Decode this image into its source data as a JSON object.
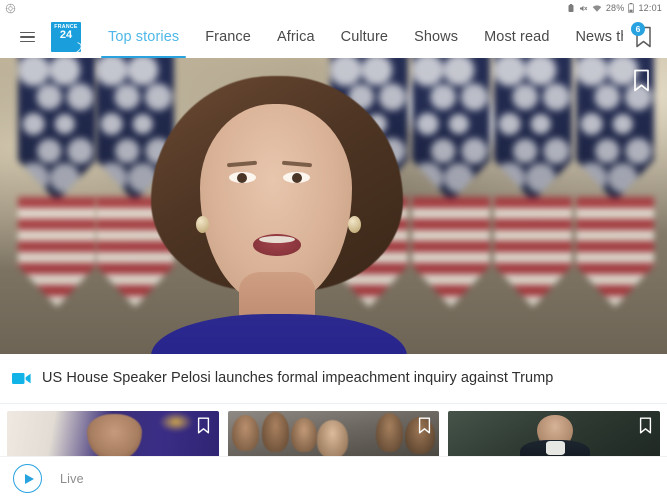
{
  "status_bar": {
    "left_icon": "notification-circle-icon",
    "icons": [
      "alarm-icon",
      "mute-icon",
      "wifi-icon"
    ],
    "battery_percent": "28%",
    "time": "12:01"
  },
  "navbar": {
    "menu_icon": "hamburger-menu-icon",
    "logo": {
      "line1": "FRANCE",
      "line2": "24",
      "color": "#1a9fdc"
    },
    "tabs": [
      {
        "label": "Top stories",
        "active": true
      },
      {
        "label": "France",
        "active": false
      },
      {
        "label": "Africa",
        "active": false
      },
      {
        "label": "Culture",
        "active": false
      },
      {
        "label": "Shows",
        "active": false
      },
      {
        "label": "Most read",
        "active": false
      },
      {
        "label": "News thread",
        "active": false
      }
    ],
    "bookmark": {
      "icon": "bookmark-icon",
      "badge_count": "6",
      "badge_color": "#29a3e0"
    },
    "active_tab_color": "#4fb8e8",
    "underline_color": "#29a3e0"
  },
  "hero": {
    "image_alt": "Nancy Pelosi speaking in front of US flags",
    "bookmark_icon": "bookmark-icon"
  },
  "headline": {
    "media_icon": "video-camera-icon",
    "media_icon_color": "#1ab4e8",
    "text": "US House Speaker Pelosi launches formal impeachment inquiry against Trump"
  },
  "thumbnails": [
    {
      "alt": "Man in front of blue backdrop",
      "bookmark_icon": "bookmark-icon"
    },
    {
      "alt": "Crowd of officials",
      "bookmark_icon": "bookmark-icon"
    },
    {
      "alt": "Emmanuel Macron at the United Nations",
      "bookmark_icon": "bookmark-icon"
    }
  ],
  "pager": {
    "indicator": "scroll-position-indicator"
  },
  "live_bar": {
    "play_icon": "play-circle-icon",
    "label": "Live",
    "accent_color": "#29a3e0"
  }
}
